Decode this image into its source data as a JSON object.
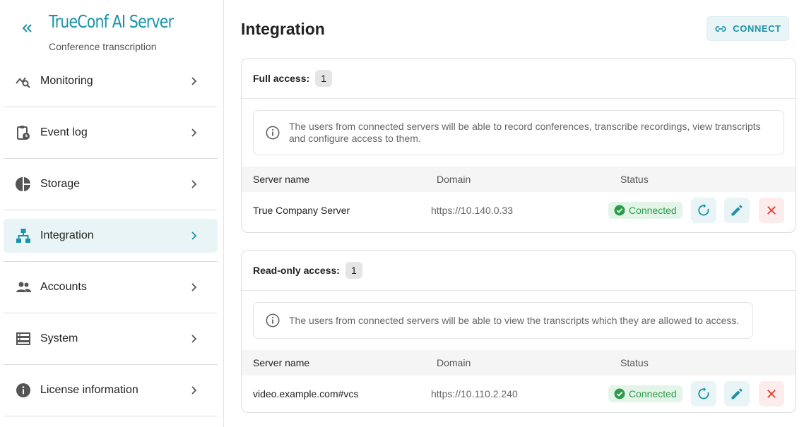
{
  "brand": {
    "title": "TrueConf AI Server",
    "subtitle": "Conference transcription"
  },
  "sidebar": {
    "items": [
      {
        "label": "Monitoring",
        "icon": "monitoring-icon",
        "active": false
      },
      {
        "label": "Event log",
        "icon": "event-log-icon",
        "active": false
      },
      {
        "label": "Storage",
        "icon": "storage-icon",
        "active": false
      },
      {
        "label": "Integration",
        "icon": "integration-icon",
        "active": true
      },
      {
        "label": "Accounts",
        "icon": "accounts-icon",
        "active": false
      },
      {
        "label": "System",
        "icon": "system-icon",
        "active": false
      },
      {
        "label": "License information",
        "icon": "info-icon",
        "active": false
      }
    ]
  },
  "main": {
    "title": "Integration",
    "connect_label": "CONNECT",
    "columns": {
      "server_name": "Server name",
      "domain": "Domain",
      "status": "Status"
    },
    "sections": [
      {
        "title": "Full access:",
        "count": "1",
        "info": "The users from connected servers will be able to record conferences, transcribe recordings, view transcripts and configure access to them.",
        "rows": [
          {
            "name": "True Company Server",
            "domain": "https://10.140.0.33",
            "status": "Connected"
          }
        ]
      },
      {
        "title": "Read-only access:",
        "count": "1",
        "info": "The users from connected servers will be able to view the transcripts which they are allowed to access.",
        "rows": [
          {
            "name": "video.example.com#vcs",
            "domain": "https://10.110.2.240",
            "status": "Connected"
          }
        ]
      }
    ]
  },
  "colors": {
    "accent": "#1a93a8",
    "success": "#2e9b4b",
    "danger": "#e53935"
  }
}
